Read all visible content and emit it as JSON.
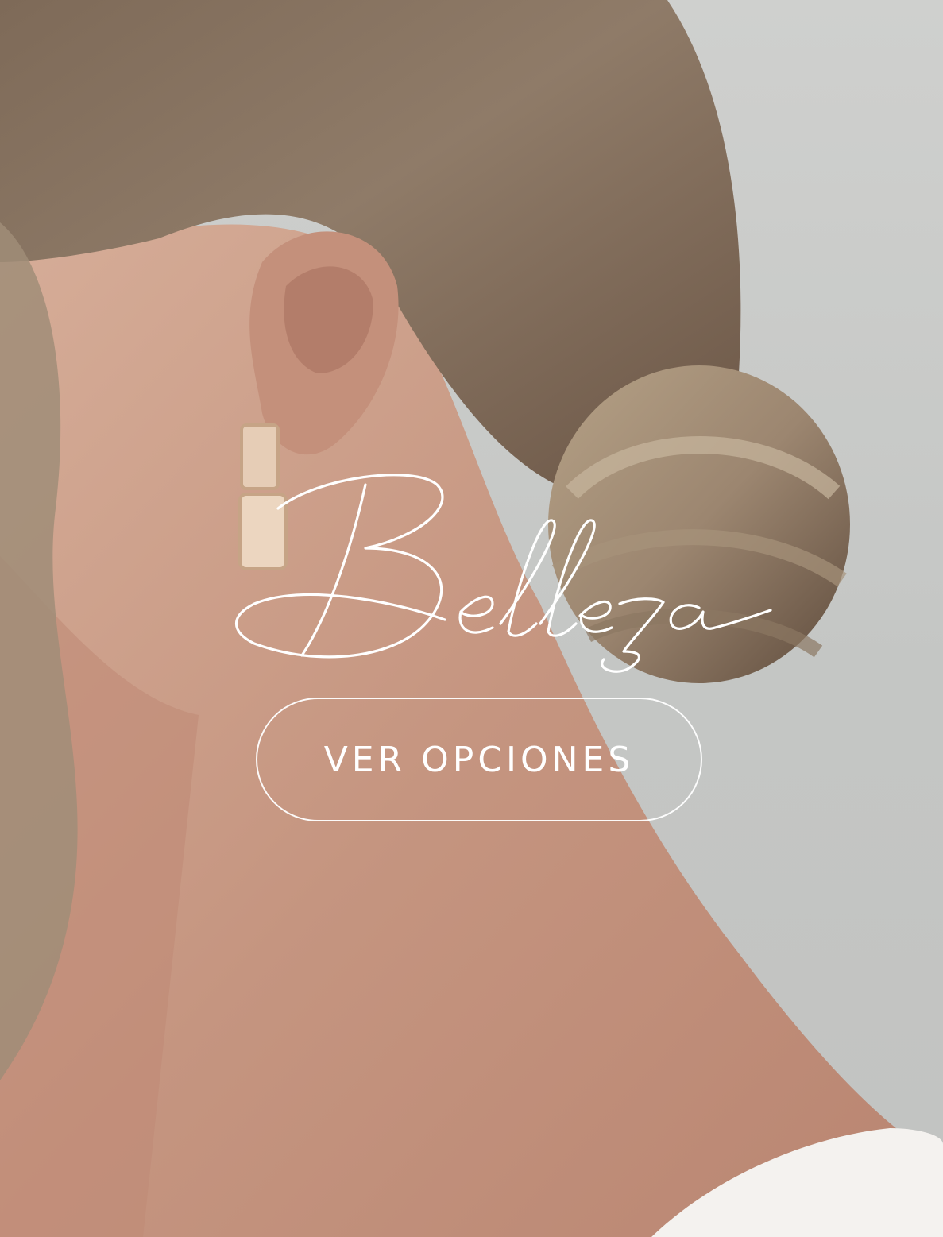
{
  "hero": {
    "title": "Belleza",
    "cta_label": "VER OPCIONES"
  },
  "colors": {
    "text": "#ffffff",
    "background": "#c9cac8",
    "hair": "#8a7562",
    "skin": "#c99b86"
  }
}
